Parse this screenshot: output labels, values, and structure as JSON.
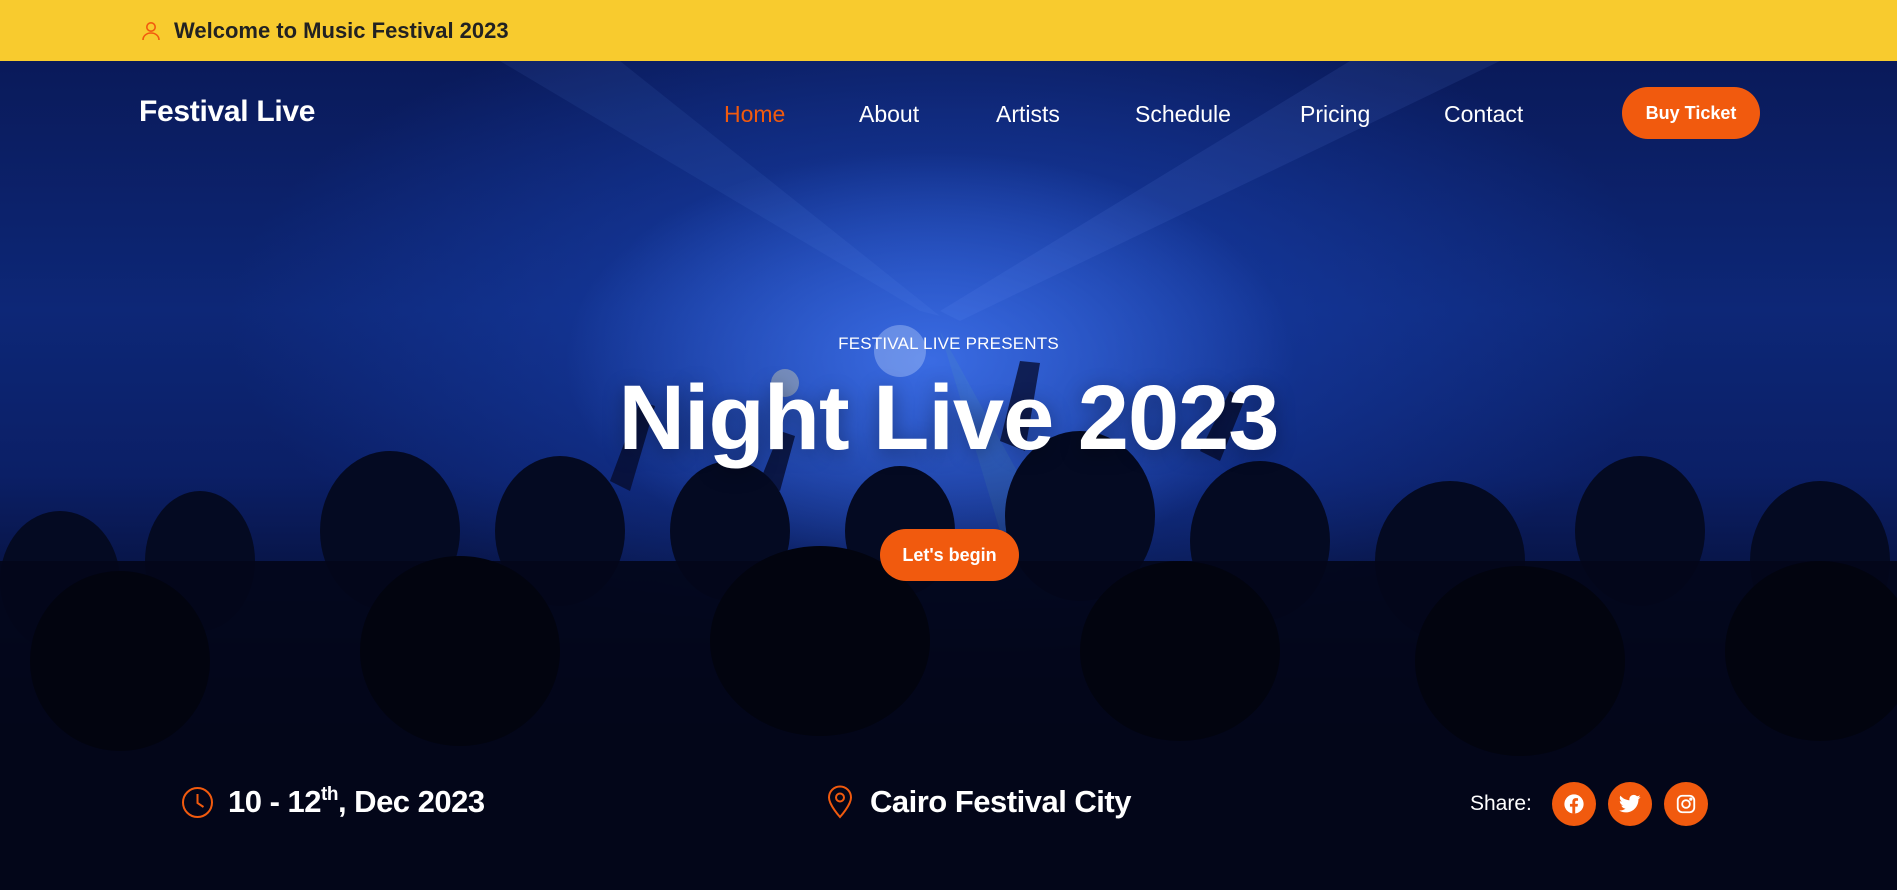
{
  "topbar": {
    "welcome": "Welcome to Music Festival 2023",
    "icon": "user-icon"
  },
  "nav": {
    "brand": "Festival Live",
    "items": [
      {
        "label": "Home",
        "active": true
      },
      {
        "label": "About",
        "active": false
      },
      {
        "label": "Artists",
        "active": false
      },
      {
        "label": "Schedule",
        "active": false
      },
      {
        "label": "Pricing",
        "active": false
      },
      {
        "label": "Contact",
        "active": false
      }
    ],
    "buy_ticket": "Buy Ticket"
  },
  "hero": {
    "presents": "FESTIVAL LIVE PRESENTS",
    "title": "Night Live 2023",
    "cta": "Let's begin"
  },
  "info": {
    "date_start": "10 - 12",
    "date_sup": "th",
    "date_rest": ", Dec 2023",
    "date_icon": "clock-icon",
    "location": "Cairo Festival City",
    "location_icon": "map-pin-icon",
    "share_label": "Share:",
    "socials": [
      "facebook-icon",
      "twitter-icon",
      "instagram-icon"
    ]
  },
  "colors": {
    "accent": "#f15a0e",
    "topbar_bg": "#f8cb2e",
    "text_dark": "#222222",
    "hero_blue": "#0d2777"
  }
}
